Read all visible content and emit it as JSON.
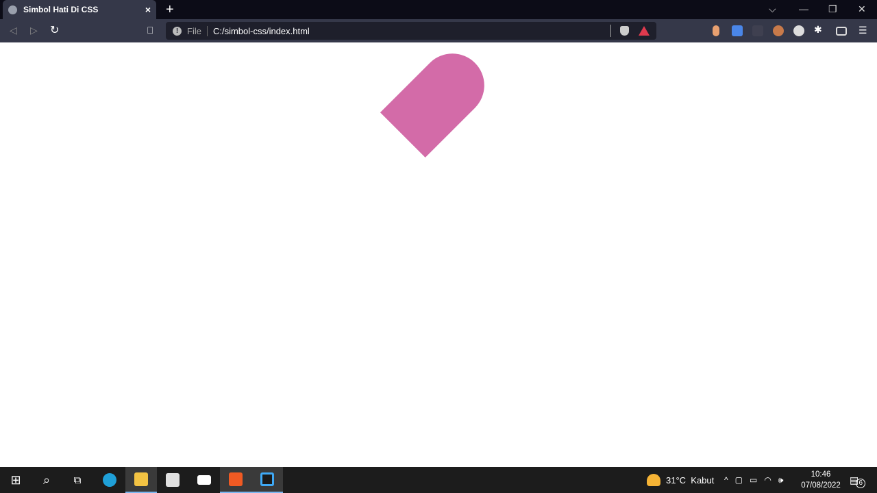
{
  "browser": {
    "tab": {
      "title": "Simbol Hati Di CSS",
      "close": "×"
    },
    "new_tab": "+",
    "window_controls": {
      "list": "⌵",
      "minimize": "—",
      "restore": "❐",
      "close": "✕"
    },
    "address": {
      "security_label": "File",
      "url": "C:/simbol-css/index.html"
    },
    "menu": "☰"
  },
  "page": {
    "shape_color": "#d36ba8"
  },
  "taskbar": {
    "weather": {
      "temp": "31°C",
      "condition": "Kabut"
    },
    "clock": {
      "time": "10:46",
      "date": "07/08/2022"
    },
    "notifications": "6"
  }
}
